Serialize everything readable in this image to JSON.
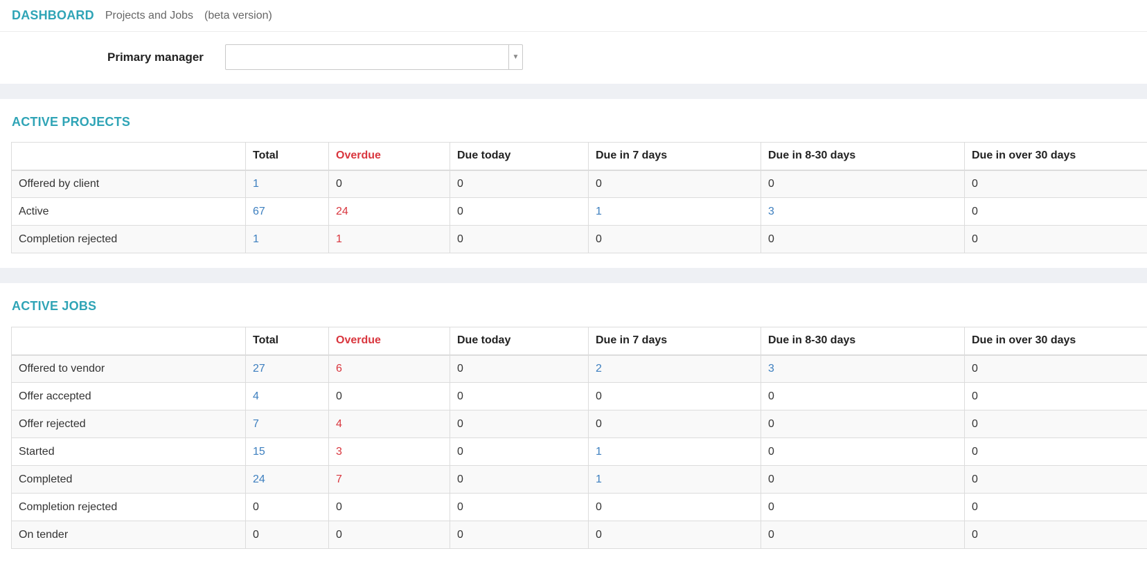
{
  "header": {
    "title": "DASHBOARD",
    "subtitle": "Projects and Jobs",
    "beta": "(beta version)"
  },
  "filter": {
    "label": "Primary manager",
    "value": ""
  },
  "projects": {
    "title": "ACTIVE PROJECTS",
    "columns": [
      "",
      "Total",
      "Overdue",
      "Due today",
      "Due in 7 days",
      "Due in 8-30 days",
      "Due in over 30 days"
    ],
    "rows": [
      {
        "label": "Offered by client",
        "cells": [
          "1",
          "0",
          "0",
          "0",
          "0",
          "0"
        ]
      },
      {
        "label": "Active",
        "cells": [
          "67",
          "24",
          "0",
          "1",
          "3",
          "0"
        ]
      },
      {
        "label": "Completion rejected",
        "cells": [
          "1",
          "1",
          "0",
          "0",
          "0",
          "0"
        ]
      }
    ]
  },
  "jobs": {
    "title": "ACTIVE JOBS",
    "columns": [
      "",
      "Total",
      "Overdue",
      "Due today",
      "Due in 7 days",
      "Due in 8-30 days",
      "Due in over 30 days"
    ],
    "rows": [
      {
        "label": "Offered to vendor",
        "cells": [
          "27",
          "6",
          "0",
          "2",
          "3",
          "0"
        ]
      },
      {
        "label": "Offer accepted",
        "cells": [
          "4",
          "0",
          "0",
          "0",
          "0",
          "0"
        ]
      },
      {
        "label": "Offer rejected",
        "cells": [
          "7",
          "4",
          "0",
          "0",
          "0",
          "0"
        ]
      },
      {
        "label": "Started",
        "cells": [
          "15",
          "3",
          "0",
          "1",
          "0",
          "0"
        ]
      },
      {
        "label": "Completed",
        "cells": [
          "24",
          "7",
          "0",
          "1",
          "0",
          "0"
        ]
      },
      {
        "label": "Completion rejected",
        "cells": [
          "0",
          "0",
          "0",
          "0",
          "0",
          "0"
        ]
      },
      {
        "label": "On tender",
        "cells": [
          "0",
          "0",
          "0",
          "0",
          "0",
          "0"
        ]
      }
    ]
  },
  "colors": {
    "accent": "#2fa4b6",
    "link": "#3d7fbf",
    "overdue": "#d9363e"
  }
}
